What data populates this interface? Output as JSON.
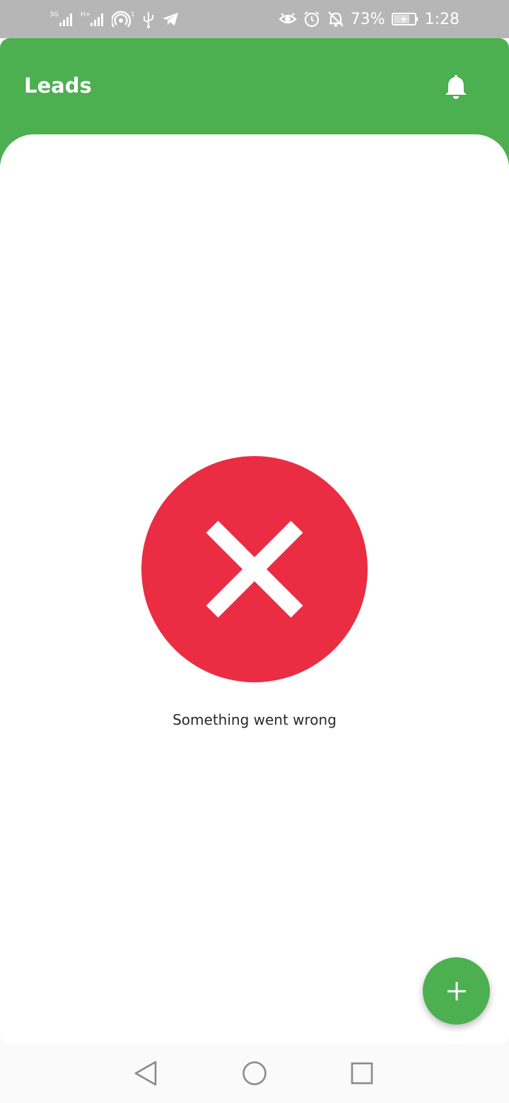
{
  "status_bar": {
    "icons_left": [
      "3g-signal-icon",
      "h-plus-signal-icon",
      "hotspot-icon",
      "usb-icon",
      "telegram-icon"
    ],
    "hotspot_count": "1",
    "network_3g_label": "3G",
    "network_h_label": "H+",
    "icons_right": [
      "eye-icon",
      "alarm-icon",
      "notifications-off-icon",
      "battery-icon"
    ],
    "battery_percent": "73%",
    "time": "1:28",
    "background_color": "#b6b6b6"
  },
  "app_bar": {
    "title": "Leads",
    "action_icon": "bell-icon",
    "color": "#4caf50"
  },
  "content": {
    "status_icon": "close-icon",
    "status_color": "#ea2d43",
    "message": "Something went wrong"
  },
  "fab": {
    "icon": "plus-icon",
    "color": "#4caf50"
  },
  "nav_bar": {
    "buttons": [
      "back-icon",
      "home-icon",
      "recents-icon"
    ]
  }
}
